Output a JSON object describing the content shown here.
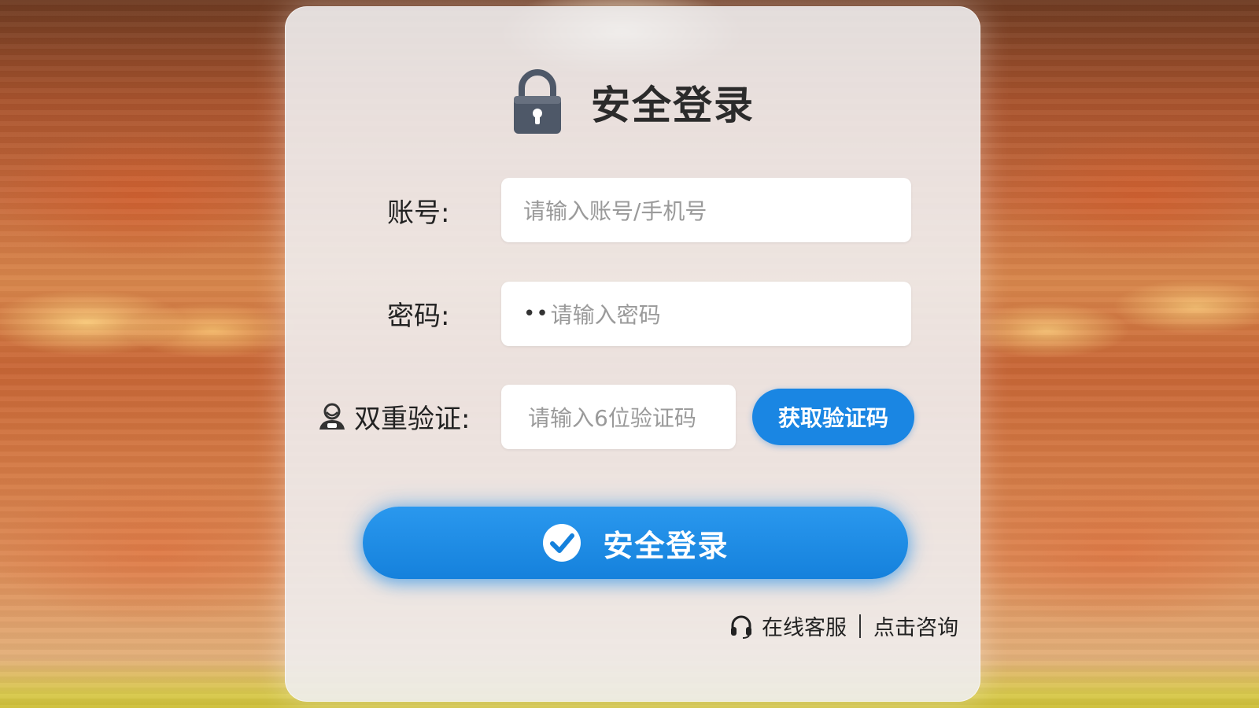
{
  "header": {
    "title": "安全登录",
    "icon": "lock-icon"
  },
  "form": {
    "account": {
      "label": "账号:",
      "placeholder": "请输入账号/手机号"
    },
    "password": {
      "label": "密码:",
      "mask": "••",
      "placeholder": "请输入密码"
    },
    "two_factor": {
      "icon": "user-shield-icon",
      "label": "双重验证:",
      "placeholder": "请输入6位验证码",
      "button_label": "获取验证码"
    }
  },
  "login_button": {
    "label": "安全登录",
    "icon": "check-circle-icon"
  },
  "support": {
    "icon": "headset-icon",
    "label": "在线客服",
    "link": "点击咨询"
  },
  "colors": {
    "accent": "#1a86e3",
    "card": "#f0eef0",
    "text": "#222222",
    "placeholder": "#9a9a9a"
  }
}
